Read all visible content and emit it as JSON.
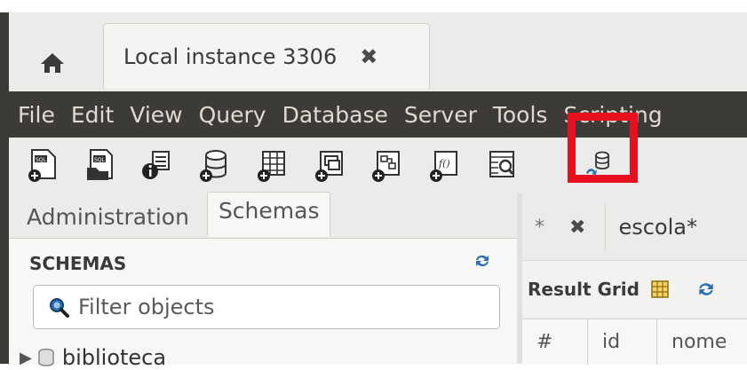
{
  "tabs": {
    "home_icon": "home-icon",
    "connection_tab": "Local instance 3306",
    "close_icon": "close-icon"
  },
  "menu": [
    "File",
    "Edit",
    "View",
    "Query",
    "Database",
    "Server",
    "Tools",
    "Scripting"
  ],
  "toolbar": {
    "icons": [
      "new-sql-tab-icon",
      "open-sql-script-icon",
      "schema-inspector-icon",
      "create-schema-icon",
      "create-table-icon",
      "create-view-icon",
      "create-procedure-icon",
      "create-function-icon",
      "search-table-data-icon",
      "reconnect-dbms-icon"
    ],
    "highlight_color": "#e8101e"
  },
  "sidebar": {
    "tabs": [
      "Administration",
      "Schemas"
    ],
    "section_title": "SCHEMAS",
    "filter_placeholder": "Filter objects",
    "tree": [
      {
        "label": "biblioteca"
      }
    ]
  },
  "editor": {
    "tab_star": "*",
    "tab_label": "escola*",
    "result_grid_label": "Result Grid",
    "columns": [
      "#",
      "id",
      "nome"
    ]
  },
  "colors": {
    "menubar_bg": "#3c3b37",
    "accent_blue": "#2b6fb6"
  }
}
